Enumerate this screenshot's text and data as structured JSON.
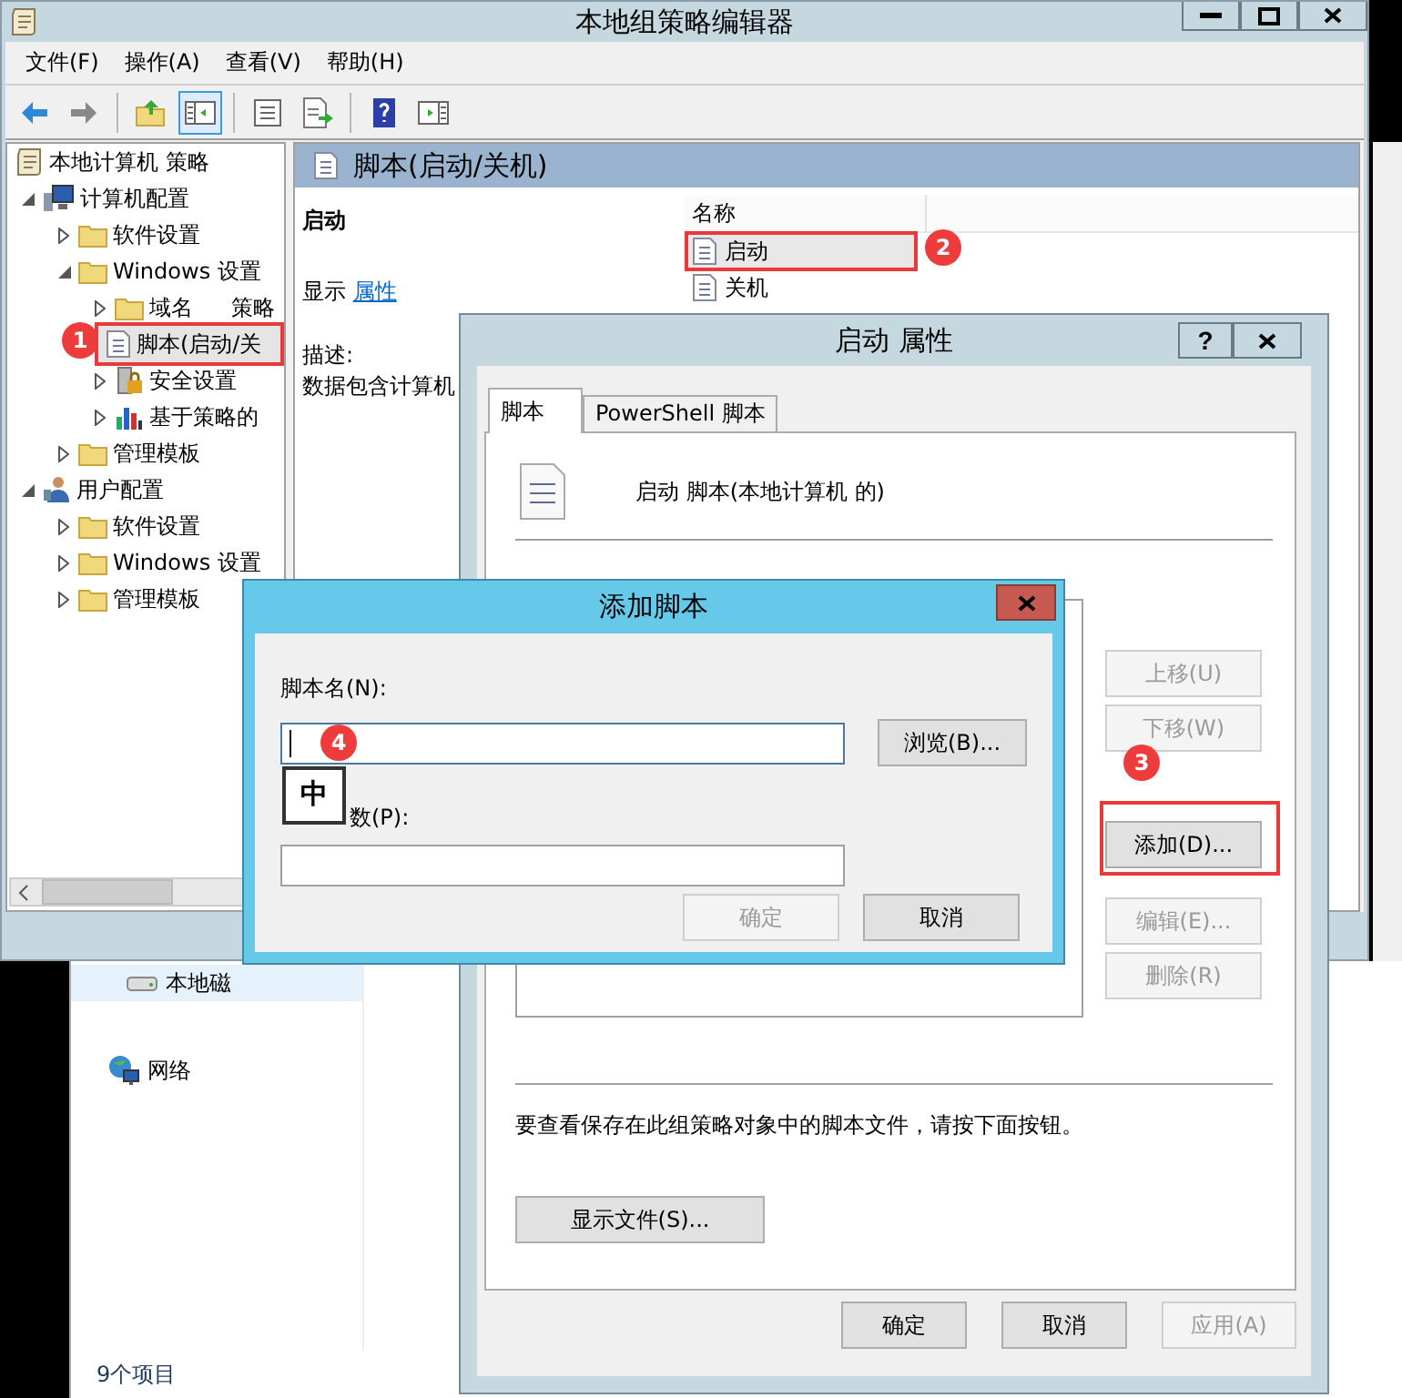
{
  "editor": {
    "title": "本地组策略编辑器",
    "menu": [
      "文件(F)",
      "操作(A)",
      "查看(V)",
      "帮助(H)"
    ],
    "toolbar": [
      {
        "kind": "back",
        "pressed": false
      },
      {
        "kind": "forward",
        "pressed": false
      },
      {
        "kind": "separator"
      },
      {
        "kind": "up",
        "pressed": false
      },
      {
        "kind": "tree",
        "pressed": true
      },
      {
        "kind": "separator"
      },
      {
        "kind": "properties",
        "pressed": false
      },
      {
        "kind": "export",
        "pressed": false
      },
      {
        "kind": "separator"
      },
      {
        "kind": "help",
        "pressed": false
      },
      {
        "kind": "view",
        "pressed": false
      }
    ],
    "tree": [
      {
        "label": "本地计算机 策略",
        "kind": "policy",
        "selected": false,
        "children": [
          {
            "label": "计算机配置",
            "kind": "computer",
            "expandable": true,
            "expanded": true,
            "selected": false,
            "children": [
              {
                "label": "软件设置",
                "kind": "folder",
                "expandable": true,
                "expanded": false,
                "selected": false
              },
              {
                "label": "Windows 设置",
                "kind": "folder",
                "expandable": true,
                "expanded": true,
                "selected": false,
                "children": [
                  {
                    "label": "域名",
                    "label_after_marker": "策略",
                    "kind": "folder",
                    "expandable": true,
                    "expanded": false,
                    "selected": false
                  },
                  {
                    "label": "脚本(启动/关",
                    "kind": "script",
                    "expandable": false,
                    "selected": true,
                    "highlighted": true,
                    "marker": "1"
                  },
                  {
                    "label": "安全设置",
                    "kind": "security",
                    "expandable": true,
                    "expanded": false,
                    "selected": false
                  },
                  {
                    "label": "基于策略的",
                    "kind": "chart",
                    "expandable": true,
                    "expanded": false,
                    "selected": false
                  }
                ]
              },
              {
                "label": "管理模板",
                "kind": "folder",
                "expandable": true,
                "expanded": false,
                "selected": false
              }
            ]
          },
          {
            "label": "用户配置",
            "kind": "user",
            "expandable": true,
            "expanded": true,
            "selected": false,
            "children": [
              {
                "label": "软件设置",
                "kind": "folder",
                "expandable": true,
                "expanded": false,
                "selected": false
              },
              {
                "label": "Windows 设置",
                "kind": "folder",
                "expandable": true,
                "expanded": false,
                "selected": false
              },
              {
                "label": "管理模板",
                "kind": "folder",
                "expandable": true,
                "expanded": false,
                "selected": false
              }
            ]
          }
        ]
      }
    ],
    "pane_title": "脚本(启动/关机)",
    "detail": {
      "heading": "启动",
      "show_label": "显示",
      "show_link": "属性",
      "description_label": "描述:",
      "description": "数据包含计算机"
    },
    "list": {
      "column": "名称",
      "items": [
        {
          "label": "启动",
          "selected": true,
          "highlighted": true,
          "marker": "2"
        },
        {
          "label": "关机",
          "selected": false,
          "highlighted": false
        }
      ]
    }
  },
  "explorer": {
    "items": [
      {
        "label": "本地磁",
        "kind": "disk",
        "selected": true
      },
      {
        "label": "网络",
        "kind": "network",
        "selected": false
      }
    ],
    "status": "9个项目"
  },
  "properties": {
    "title": "启动 属性",
    "help_glyph": "?",
    "tabs": [
      {
        "label": "脚本",
        "selected": true
      },
      {
        "label": "PowerShell 脚本",
        "selected": false
      }
    ],
    "heading": "启动 脚本(本地计算机 的)",
    "side_buttons": [
      {
        "label": "上移(U)",
        "disabled": true,
        "highlighted": false
      },
      {
        "label": "下移(W)",
        "disabled": true,
        "highlighted": false
      },
      {
        "label": "添加(D)...",
        "disabled": false,
        "highlighted": true,
        "marker": "3"
      },
      {
        "label": "编辑(E)...",
        "disabled": true,
        "highlighted": false
      },
      {
        "label": "删除(R)",
        "disabled": true,
        "highlighted": false
      }
    ],
    "hint": "要查看保存在此组策略对象中的脚本文件，请按下面按钮。",
    "show_files": "显示文件(S)...",
    "buttons": [
      {
        "label": "确定",
        "disabled": false
      },
      {
        "label": "取消",
        "disabled": false
      },
      {
        "label": "应用(A)",
        "disabled": true
      }
    ]
  },
  "add_dialog": {
    "title": "添加脚本",
    "name_label": "脚本名(N):",
    "name_marker": "4",
    "browse": "浏览(B)...",
    "ime": "中",
    "params_label": "数(P):",
    "buttons": [
      {
        "label": "确定",
        "disabled": true
      },
      {
        "label": "取消",
        "disabled": false
      }
    ]
  }
}
